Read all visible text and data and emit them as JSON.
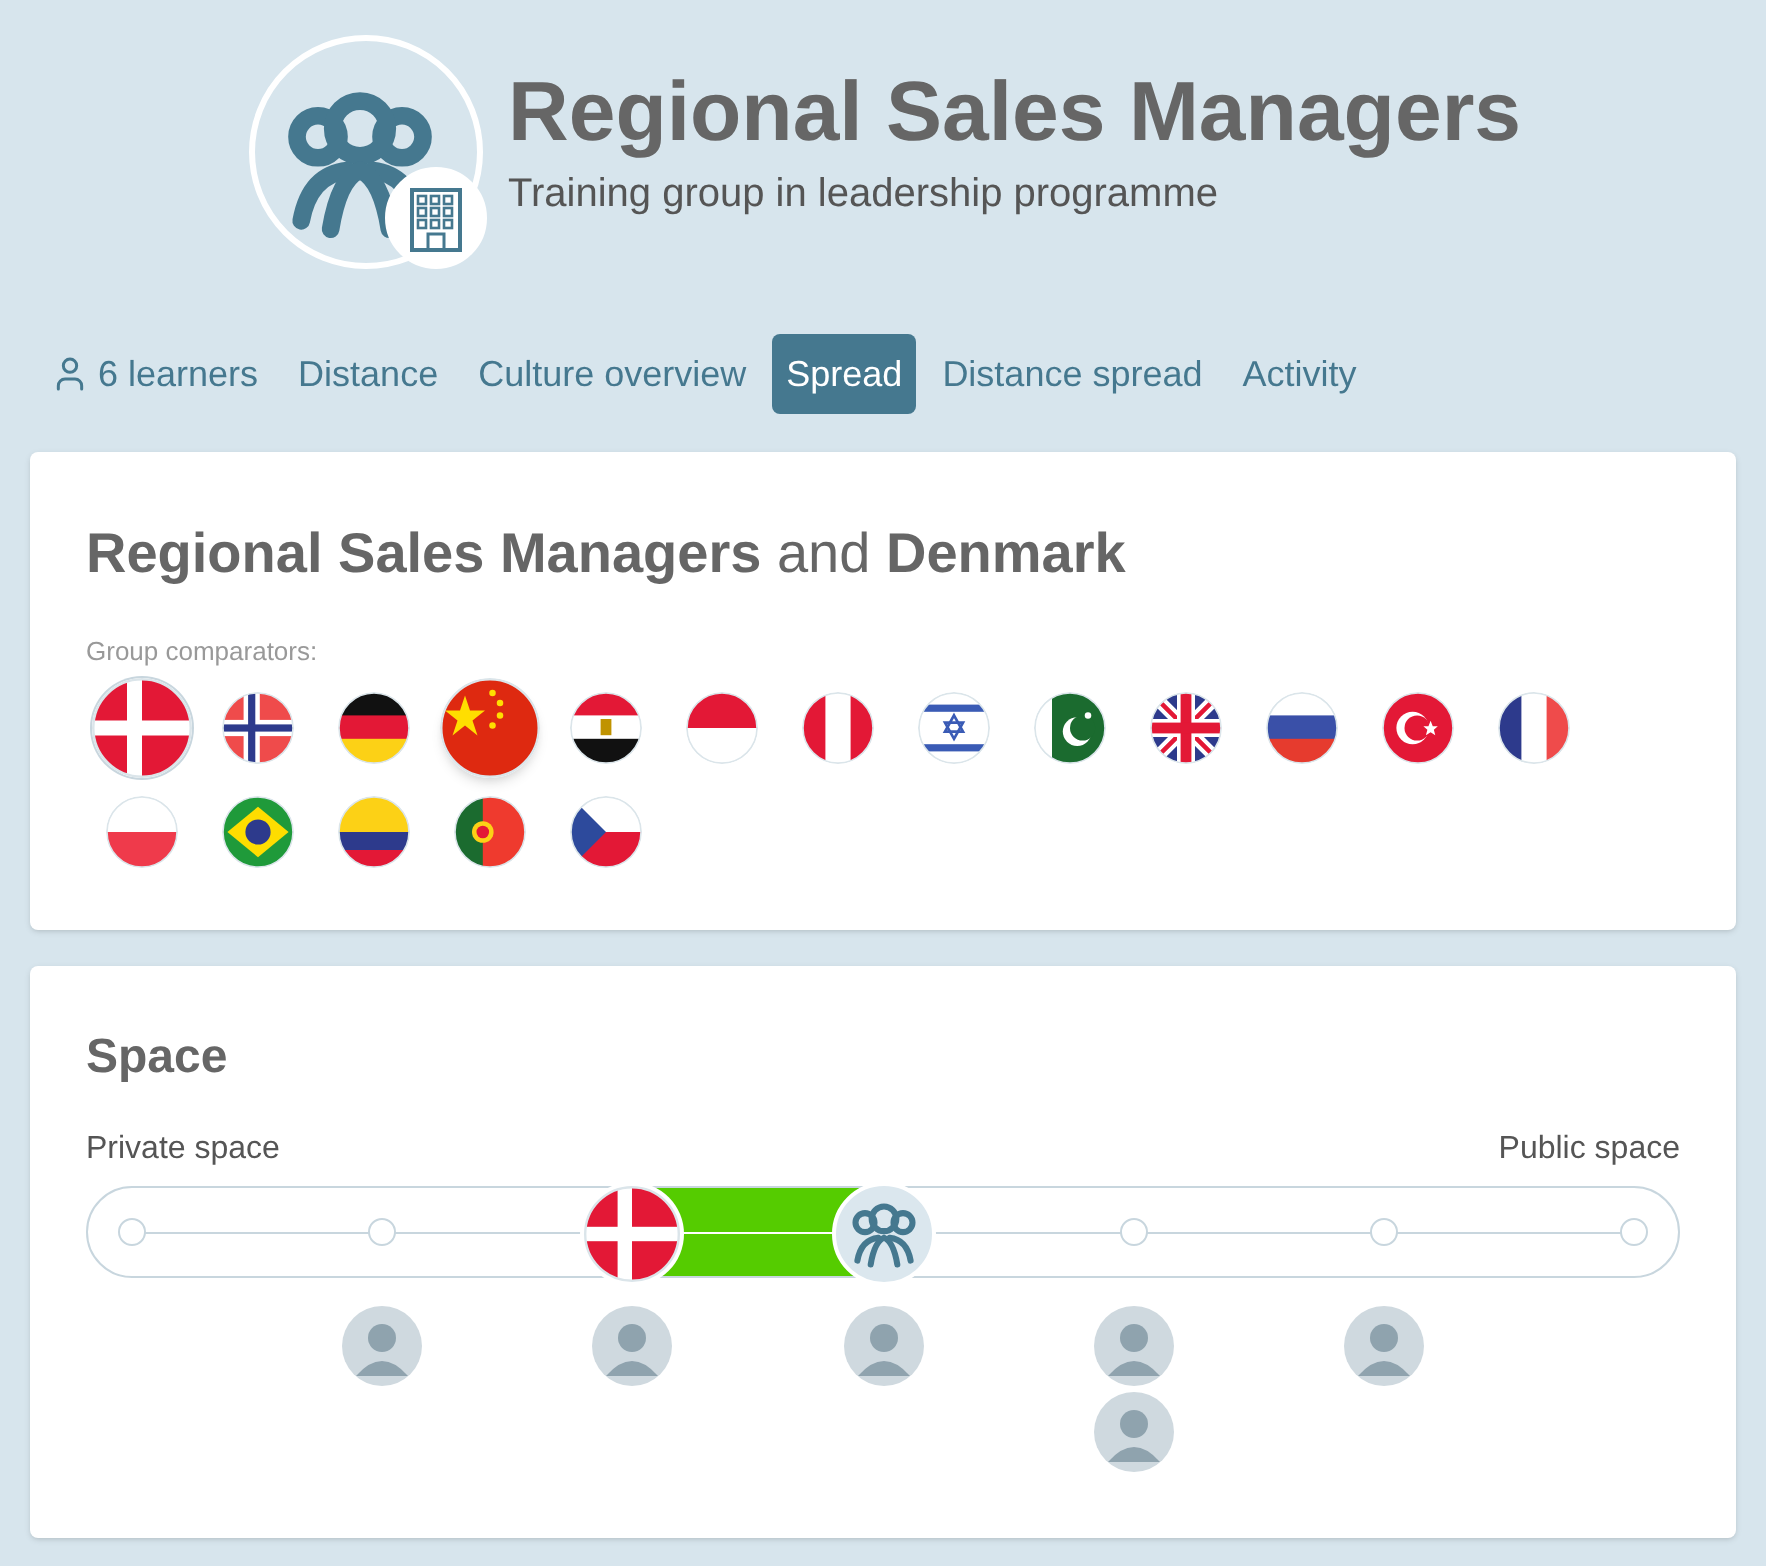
{
  "header": {
    "title": "Regional Sales Managers",
    "subtitle": "Training group in leadership programme"
  },
  "tabs": [
    {
      "kind": "learners",
      "label": "6 learners",
      "selected": false
    },
    {
      "kind": "plain",
      "label": "Distance",
      "selected": false
    },
    {
      "kind": "plain",
      "label": "Culture overview",
      "selected": false
    },
    {
      "kind": "plain",
      "label": "Spread",
      "selected": true
    },
    {
      "kind": "plain",
      "label": "Distance spread",
      "selected": false
    },
    {
      "kind": "plain",
      "label": "Activity",
      "selected": false
    }
  ],
  "comparison": {
    "title": "**Regional Sales Managers** and **Denmark**",
    "comparators_label": "Group comparators:",
    "flags": [
      {
        "kind": "denmark",
        "selected": true,
        "hovered": false
      },
      {
        "kind": "norway",
        "selected": false,
        "hovered": false
      },
      {
        "kind": "germany",
        "selected": false,
        "hovered": false
      },
      {
        "kind": "china",
        "selected": false,
        "hovered": true
      },
      {
        "kind": "egypt",
        "selected": false,
        "hovered": false
      },
      {
        "kind": "indonesia",
        "selected": false,
        "hovered": false
      },
      {
        "kind": "peru",
        "selected": false,
        "hovered": false
      },
      {
        "kind": "israel",
        "selected": false,
        "hovered": false
      },
      {
        "kind": "pakistan",
        "selected": false,
        "hovered": false
      },
      {
        "kind": "uk",
        "selected": false,
        "hovered": false
      },
      {
        "kind": "russia",
        "selected": false,
        "hovered": false
      },
      {
        "kind": "turkey",
        "selected": false,
        "hovered": false
      },
      {
        "kind": "france",
        "selected": false,
        "hovered": false
      },
      {
        "kind": "poland",
        "selected": false,
        "hovered": false
      },
      {
        "kind": "brazil",
        "selected": false,
        "hovered": false
      },
      {
        "kind": "colombia",
        "selected": false,
        "hovered": false
      },
      {
        "kind": "portugal",
        "selected": false,
        "hovered": false
      },
      {
        "kind": "czech",
        "selected": false,
        "hovered": false
      }
    ]
  },
  "space": {
    "title": "Space",
    "left_label": "Private space",
    "right_label": "Public space",
    "country_marker": {
      "kind": "denmark",
      "level": 0.3333
    },
    "group_marker": {
      "level": 0.5
    },
    "learners": [
      {
        "level": 0.1667
      },
      {
        "level": 0.3333
      },
      {
        "level": 0.5
      },
      {
        "level": 0.6667
      },
      {
        "level": 0.6667
      },
      {
        "level": 0.8333
      }
    ]
  }
}
